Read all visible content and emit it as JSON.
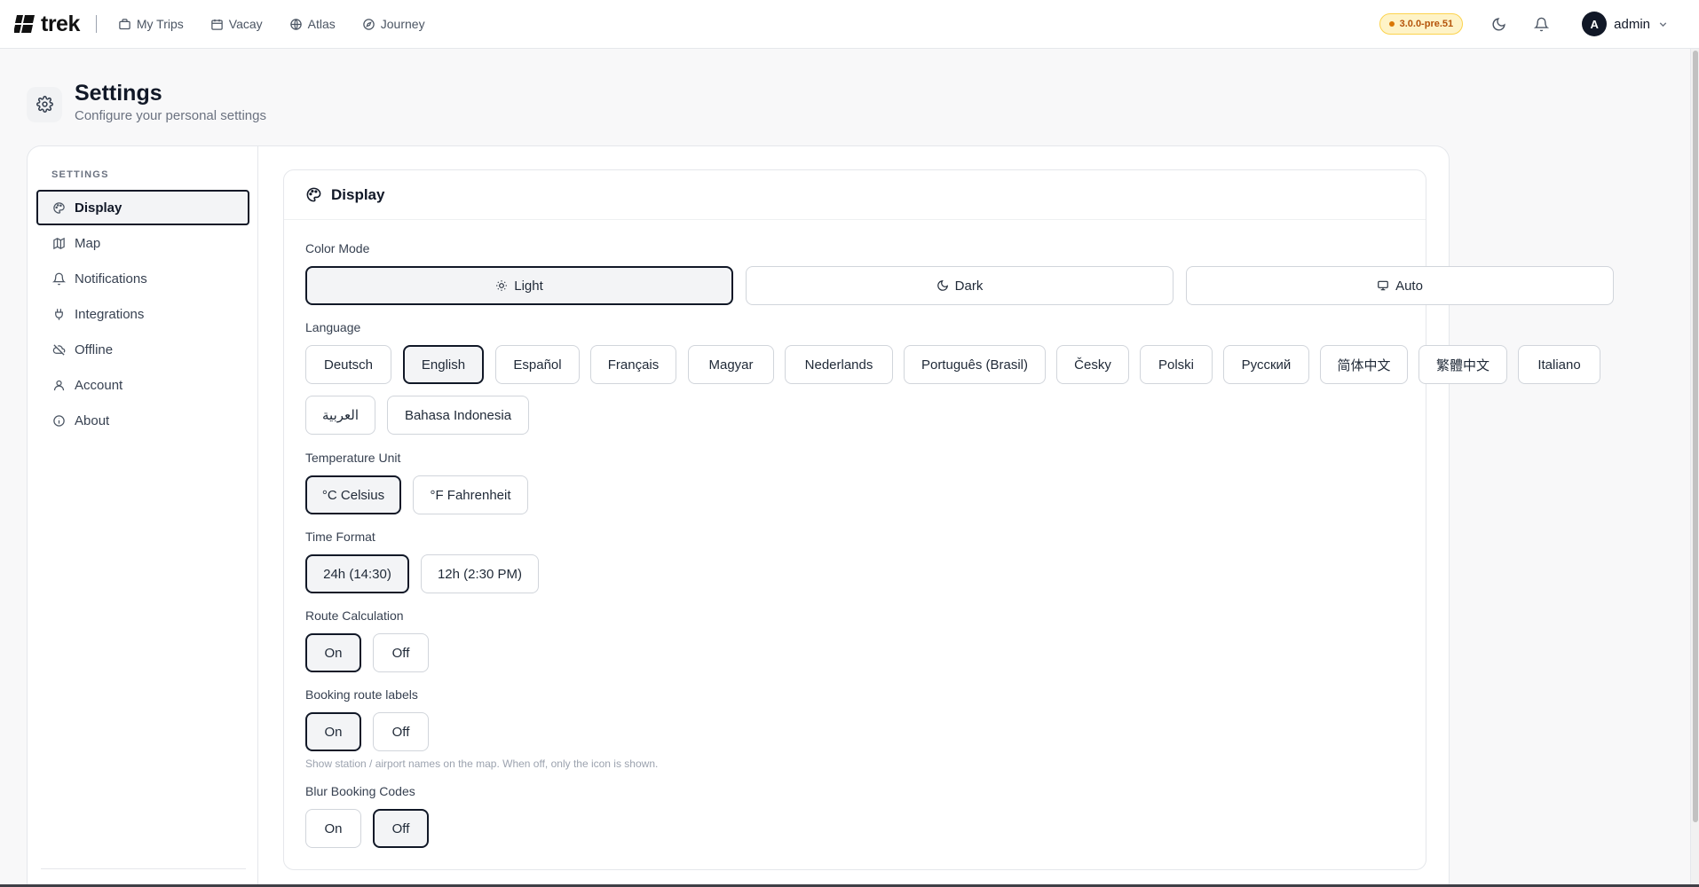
{
  "brand": {
    "name": "trek"
  },
  "nav": [
    {
      "label": "My Trips",
      "icon": "briefcase-icon"
    },
    {
      "label": "Vacay",
      "icon": "calendar-icon"
    },
    {
      "label": "Atlas",
      "icon": "globe-icon"
    },
    {
      "label": "Journey",
      "icon": "compass-icon"
    }
  ],
  "header_right": {
    "version": "3.0.0-pre.51",
    "user_initial": "A",
    "user_name": "admin"
  },
  "page": {
    "title": "Settings",
    "subtitle": "Configure your personal settings"
  },
  "sidebar": {
    "heading": "SETTINGS",
    "items": [
      {
        "label": "Display",
        "icon": "palette-icon",
        "active": true
      },
      {
        "label": "Map",
        "icon": "map-icon"
      },
      {
        "label": "Notifications",
        "icon": "bell-icon"
      },
      {
        "label": "Integrations",
        "icon": "plug-icon"
      },
      {
        "label": "Offline",
        "icon": "cloud-off-icon"
      },
      {
        "label": "Account",
        "icon": "user-icon"
      },
      {
        "label": "About",
        "icon": "info-icon"
      }
    ]
  },
  "display": {
    "title": "Display",
    "color_mode": {
      "label": "Color Mode",
      "options": [
        "Light",
        "Dark",
        "Auto"
      ],
      "selected": "Light"
    },
    "language": {
      "label": "Language",
      "options": [
        "Deutsch",
        "English",
        "Español",
        "Français",
        "Magyar",
        "Nederlands",
        "Português (Brasil)",
        "Česky",
        "Polski",
        "Русский",
        "简体中文",
        "繁體中文",
        "Italiano",
        "العربية",
        "Bahasa Indonesia"
      ],
      "selected": "English"
    },
    "temperature": {
      "label": "Temperature Unit",
      "options": [
        "°C Celsius",
        "°F Fahrenheit"
      ],
      "selected": "°C Celsius"
    },
    "time_format": {
      "label": "Time Format",
      "options": [
        "24h (14:30)",
        "12h (2:30 PM)"
      ],
      "selected": "24h (14:30)"
    },
    "route_calculation": {
      "label": "Route Calculation",
      "options": [
        "On",
        "Off"
      ],
      "selected": "On"
    },
    "booking_route_labels": {
      "label": "Booking route labels",
      "options": [
        "On",
        "Off"
      ],
      "selected": "On",
      "helper": "Show station / airport names on the map. When off, only the icon is shown."
    },
    "blur_booking_codes": {
      "label": "Blur Booking Codes",
      "options": [
        "On",
        "Off"
      ],
      "selected": "Off"
    }
  },
  "colors": {
    "accent": "#111827",
    "badge_bg": "#fef3c7",
    "badge_text": "#b45309"
  }
}
